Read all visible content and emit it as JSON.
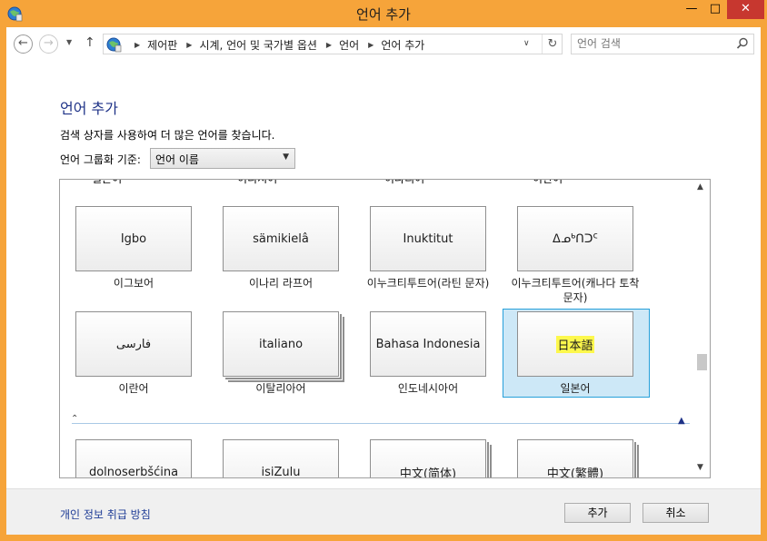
{
  "window": {
    "title": "언어 추가",
    "minimize_glyph": "—",
    "maximize_glyph": "□",
    "close_glyph": "✕"
  },
  "nav": {
    "back_glyph": "←",
    "forward_glyph": "→",
    "recent_glyph": "▼",
    "up_glyph": "↑",
    "breadcrumb": [
      "제어판",
      "시계, 언어 및 국가별 옵션",
      "언어",
      "언어 추가"
    ],
    "dropdown_glyph": "∨",
    "refresh_glyph": "↻"
  },
  "search": {
    "placeholder": "언어 검색"
  },
  "content": {
    "title": "언어 추가",
    "description": "검색 상자를 사용하여 더 많은 언어를 찾습니다.",
    "group_label": "언어 그룹화 기준:",
    "group_value": "언어 이름",
    "group_arrow": "⌄"
  },
  "languages": [
    {
      "native": "Igbo",
      "name": "이그보어"
    },
    {
      "native": "sämikielâ",
      "name": "이나리 라프어"
    },
    {
      "native": "Inuktitut",
      "name": "이누크티투트어(라틴 문자)"
    },
    {
      "native": "ᐃᓄᒃᑎᑐᑦ",
      "name": "이누크티투트어(캐나다 토착",
      "name2": "문자)"
    },
    {
      "native": "فارسی",
      "name": "이란어"
    },
    {
      "native": "italiano",
      "name": "이탈리아어"
    },
    {
      "native": "Bahasa Indonesia",
      "name": "인도네시아어"
    },
    {
      "native": "日本語",
      "name": "일본어"
    },
    {
      "native": "dolnoserbšćina",
      "name": ""
    },
    {
      "native": "isiZulu",
      "name": ""
    },
    {
      "native": "中文(简体)",
      "name": ""
    },
    {
      "native": "中文(繁體)",
      "name": ""
    }
  ],
  "cut_labels": [
    "일본어",
    "이디시어",
    "이나리어",
    "이란어"
  ],
  "group": {
    "collapse_left": "⌃",
    "collapse_right": "▲"
  },
  "scrollbar": {
    "up": "▲",
    "down": "▼"
  },
  "footer": {
    "privacy_link": "개인 정보 취급 방침",
    "add_label": "추가",
    "cancel_label": "취소"
  },
  "colors": {
    "accent": "#f6a43a",
    "selection": "#cde8f7",
    "link": "#1e3c96",
    "title": "#1e3287"
  }
}
